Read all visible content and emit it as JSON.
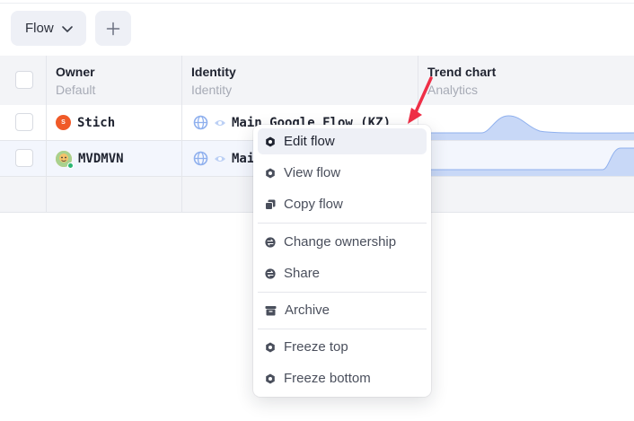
{
  "toolbar": {
    "flow_label": "Flow"
  },
  "columns": [
    {
      "title": "Owner",
      "subtitle": "Default"
    },
    {
      "title": "Identity",
      "subtitle": "Identity"
    },
    {
      "title": "Trend chart",
      "subtitle": "Analytics"
    }
  ],
  "rows": [
    {
      "owner": "Stich",
      "avatar_text": "S",
      "identity": "Main Google Flow (KZ)"
    },
    {
      "owner": "MVDMVN",
      "avatar_text": "",
      "identity": "Mai"
    }
  ],
  "context_menu": {
    "items": [
      {
        "label": "Edit flow",
        "icon": "gear-icon"
      },
      {
        "label": "View flow",
        "icon": "gear-icon"
      },
      {
        "label": "Copy flow",
        "icon": "copy-icon"
      },
      {
        "label": "Change ownership",
        "icon": "swap-icon"
      },
      {
        "label": "Share",
        "icon": "swap-icon"
      },
      {
        "label": "Archive",
        "icon": "archive-icon"
      },
      {
        "label": "Freeze top",
        "icon": "gear-icon"
      },
      {
        "label": "Freeze bottom",
        "icon": "gear-icon"
      }
    ]
  },
  "colors": {
    "accent_arrow": "#ef2f47",
    "sparkline_fill": "#c8d8f7",
    "sparkline_stroke": "#8fb0ee",
    "row_selected": "#f3f6fd"
  }
}
